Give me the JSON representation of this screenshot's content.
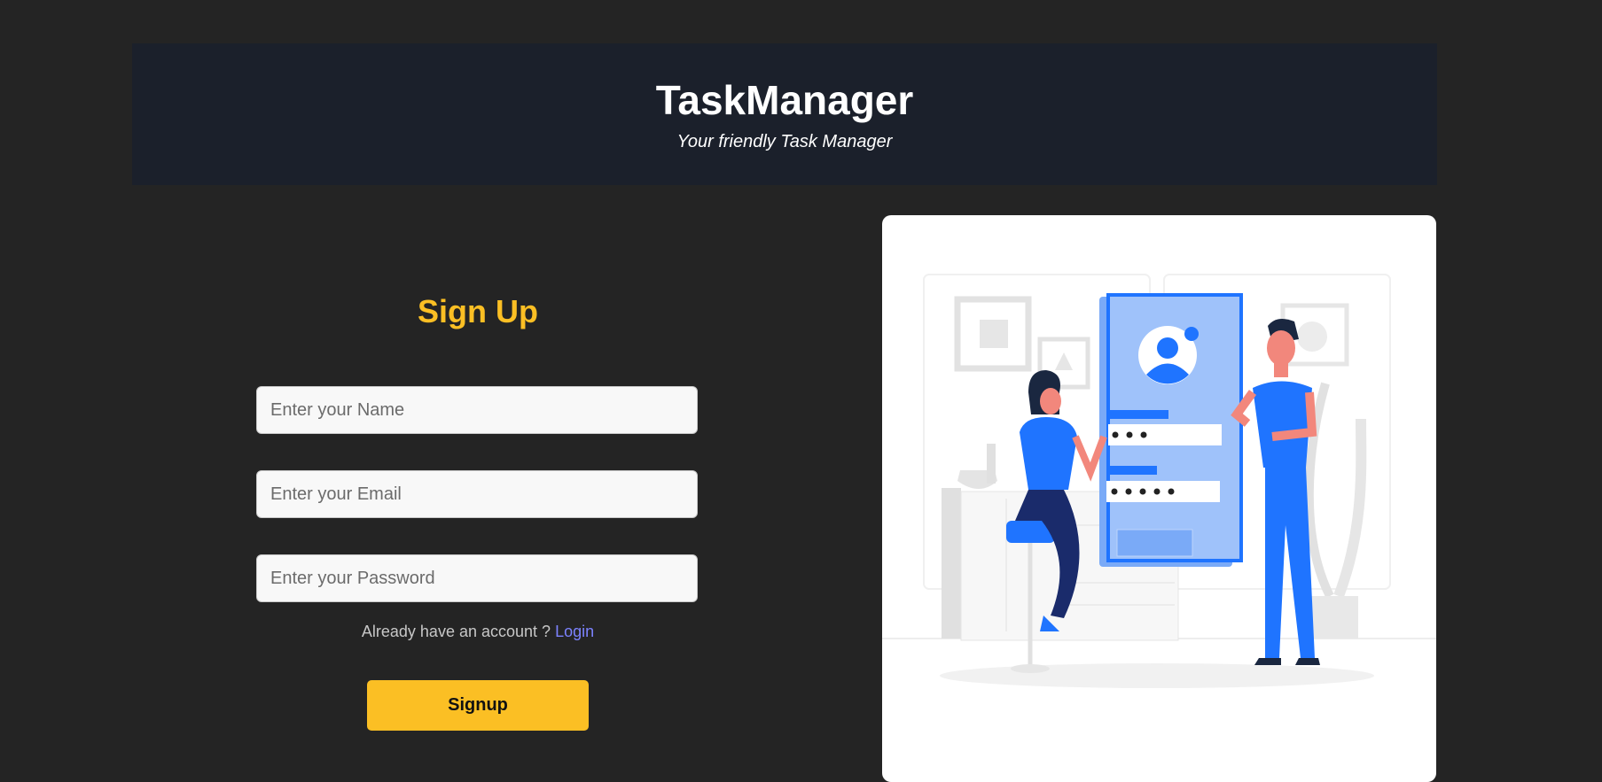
{
  "header": {
    "title": "TaskManager",
    "subtitle": "Your friendly Task Manager"
  },
  "form": {
    "title": "Sign Up",
    "name_placeholder": "Enter your Name",
    "email_placeholder": "Enter your Email",
    "password_placeholder": "Enter your Password",
    "account_prompt": "Already have an account ?",
    "login_label": "Login",
    "signup_label": "Signup"
  },
  "colors": {
    "background": "#242424",
    "header_background": "#1b202b",
    "accent": "#fbbf24",
    "link": "#7c83ff",
    "illustration_blue": "#1f74ff"
  },
  "illustration": {
    "icon": "signup-illustration"
  }
}
